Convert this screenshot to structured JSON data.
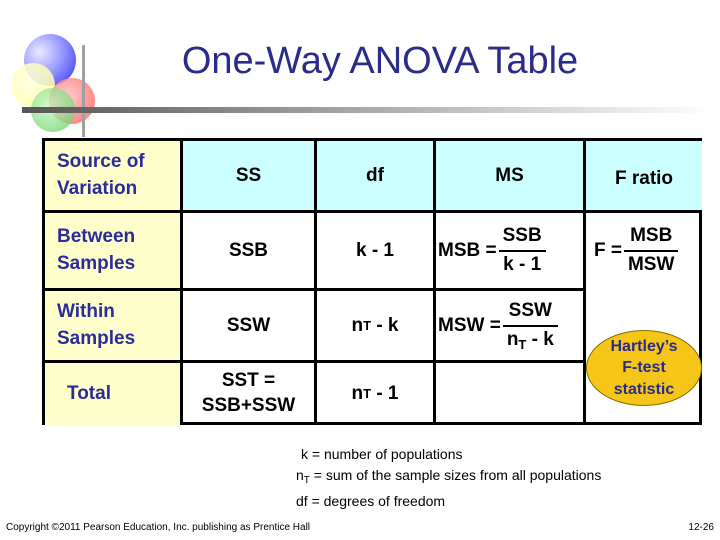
{
  "title": "One-Way ANOVA Table",
  "table": {
    "headers": [
      "Source of Variation",
      "SS",
      "df",
      "MS",
      "F ratio"
    ],
    "rows": [
      {
        "source": "Between Samples",
        "ss": "SSB",
        "df_main": "k - 1",
        "df_sub": "",
        "df_rest": "",
        "ms_label": "MSB =",
        "ms_num": "SSB",
        "ms_den": "k - 1"
      },
      {
        "source": "Within Samples",
        "ss": "SSW",
        "df_main": "n",
        "df_sub": "T",
        "df_rest": " - k",
        "ms_label": "MSW =",
        "ms_num": "SSW",
        "ms_den_main": "n",
        "ms_den_sub": "T",
        "ms_den_rest": " - k"
      },
      {
        "source": "Total",
        "ss_line1": "SST =",
        "ss_line2": "SSB+SSW",
        "df_main": "n",
        "df_sub": "T",
        "df_rest": " - 1"
      }
    ],
    "f_ratio": {
      "label": "F =",
      "num": "MSB",
      "den": "MSW"
    },
    "callout": [
      "Hartley’s",
      "F-test",
      "statistic"
    ]
  },
  "notes": [
    {
      "main": "k",
      "sub": "",
      "text": " = number of populations"
    },
    {
      "main": "n",
      "sub": "T",
      "text": " = sum of the sample sizes from all populations"
    },
    {
      "main": "df",
      "sub": "",
      "text": " = degrees of freedom"
    }
  ],
  "footer": {
    "copyright": "Copyright ©2011 Pearson Education, Inc. publishing as Prentice Hall",
    "page": "12-26"
  },
  "colors": {
    "title": "#2b2b8a",
    "source_col_bg": "#ffffcc",
    "header_bg": "#ccffff",
    "callout": "#f5c518"
  }
}
